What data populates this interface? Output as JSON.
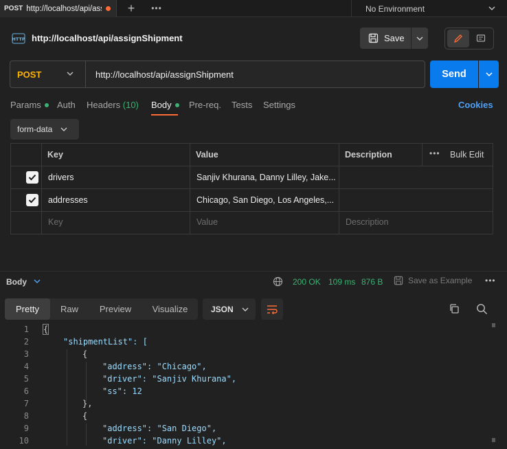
{
  "tab": {
    "method": "POST",
    "url": "http://localhost/api/assignShipment"
  },
  "environment": "No Environment",
  "request": {
    "title": "http://localhost/api/assignShipment",
    "save_label": "Save",
    "method": "POST",
    "url": "http://localhost/api/assignShipment",
    "send_label": "Send"
  },
  "request_tabs": {
    "params": "Params",
    "auth": "Auth",
    "headers": "Headers",
    "headers_count": "(10)",
    "body": "Body",
    "prereq": "Pre-req.",
    "tests": "Tests",
    "settings": "Settings",
    "cookies": "Cookies"
  },
  "body_type": "form-data",
  "params_table": {
    "headers": {
      "key": "Key",
      "value": "Value",
      "description": "Description",
      "bulk_edit": "Bulk Edit"
    },
    "rows": [
      {
        "checked": true,
        "key": "drivers",
        "value": "Sanjiv Khurana, Danny Lilley, Jake..."
      },
      {
        "checked": true,
        "key": "addresses",
        "value": "Chicago, San Diego, Los Angeles,..."
      }
    ],
    "placeholder": {
      "key": "Key",
      "value": "Value",
      "description": "Description"
    }
  },
  "response": {
    "label": "Body",
    "status": "200 OK",
    "time": "109 ms",
    "size": "876 B",
    "save_example": "Save as Example",
    "views": {
      "pretty": "Pretty",
      "raw": "Raw",
      "preview": "Preview",
      "visualize": "Visualize"
    },
    "format": "JSON",
    "code_lines": [
      "{",
      "\"shipmentList\": [",
      "{",
      "\"address\": \"Chicago\",",
      "\"driver\": \"Sanjiv Khurana\",",
      "\"ss\": 12",
      "},",
      "{",
      "\"address\": \"San Diego\",",
      "\"driver\": \"Danny Lilley\","
    ]
  },
  "colors": {
    "accent": "#ff6c37",
    "send": "#097bed",
    "method": "#ffb400",
    "success": "#3bb273",
    "link": "#4fa1f5"
  }
}
